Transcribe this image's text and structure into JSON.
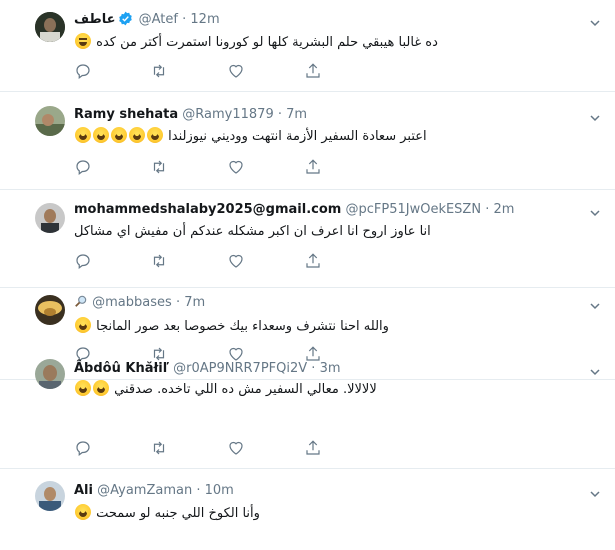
{
  "tweets": [
    {
      "name": "عاطف",
      "verified": true,
      "handle": "@Atef",
      "time": "12m",
      "text": "ده غالبا هيبقي حلم البشرية كلها لو كورونا استمرت أكتر من كده",
      "emojis": [
        "joy-icon"
      ],
      "avatar_color": "#3b4a3a"
    },
    {
      "name": "Ramy shehata",
      "verified": false,
      "handle": "@Ramy11879",
      "time": "7m",
      "text": "اعتبر سعادة السفير الأزمة انتهت ووديني نيوزلندا",
      "emojis": [
        "grin-icon",
        "grin-icon",
        "grin-icon",
        "grin-icon",
        "grin-icon"
      ],
      "avatar_color": "#6b7a5a"
    },
    {
      "name": "mohammedshalaby2025@gmail.com",
      "verified": false,
      "handle": "@pcFP51JwOekESZN",
      "time": "2m",
      "text": "انا عاوز اروح انا اعرف ان اكبر مشكله عندكم أن مفيش اي مشاكل",
      "emojis": [],
      "avatar_color": "#2e3338"
    },
    {
      "name": "🔎",
      "verified": false,
      "handle": "@mabbases",
      "time": "7m",
      "text": "والله احنا نتشرف وسعداء بيك خصوصا بعد صور المانجا",
      "emojis": [
        "grin-icon"
      ],
      "avatar_color": "#c9a040"
    },
    {
      "name": "Âbdôû Khăłiľ",
      "verified": false,
      "handle": "@r0AP9NRR7PFQi2V",
      "time": "3m",
      "text": "لالالالا. معالي السفير مش ده اللي تاخده. صدقني",
      "emojis": [
        "grin-icon",
        "grin-icon"
      ],
      "avatar_color": "#7d8a78"
    },
    {
      "name": "Ali",
      "verified": false,
      "handle": "@AyamZaman",
      "time": "10m",
      "text": "وأنا الكوخ اللي جنبه لو سمحت",
      "emojis": [
        "smile-icon"
      ],
      "avatar_color": "#4a6a8a"
    }
  ],
  "separator": "·",
  "action_icons": [
    "reply-icon",
    "retweet-icon",
    "like-icon",
    "share-icon"
  ],
  "colors": {
    "text": "#14171a",
    "muted": "#657786",
    "verified": "#1da1f2",
    "icon": "#657786",
    "divider": "#e6ecf0"
  }
}
